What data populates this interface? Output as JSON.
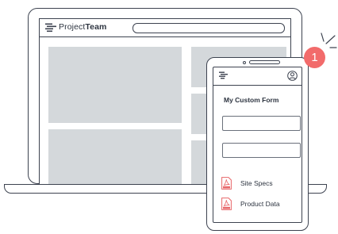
{
  "app": {
    "logo_regular": "Project",
    "logo_bold": "Team"
  },
  "phone": {
    "form_title": "My Custom Form",
    "files": [
      {
        "label": "Site Specs",
        "icon": "pdf-file-icon"
      },
      {
        "label": "Product Data",
        "icon": "pdf-file-icon"
      }
    ]
  },
  "badge": {
    "number": "1"
  },
  "colors": {
    "outline": "#3d4350",
    "placeholder_gray": "#d4d8db",
    "badge_red": "#f26b6b",
    "pdf_red": "#e8676a"
  }
}
